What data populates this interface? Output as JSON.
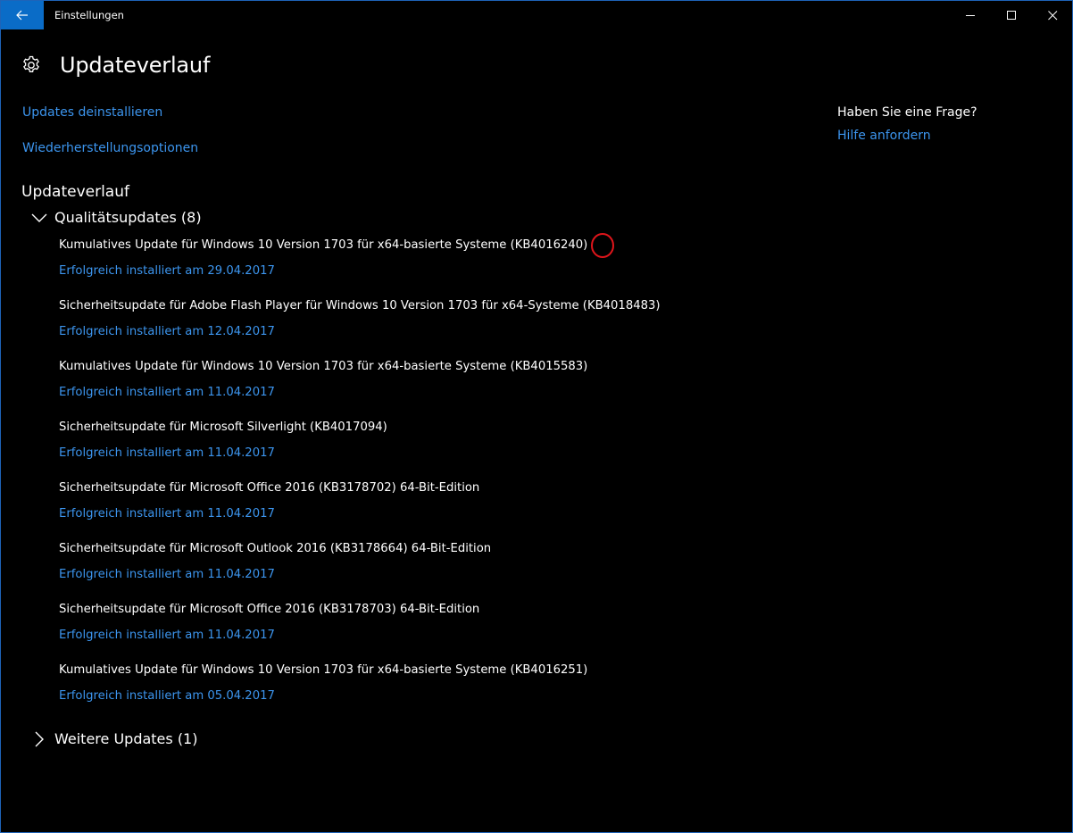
{
  "window": {
    "title": "Einstellungen",
    "accent_color": "#0a6cc7"
  },
  "header": {
    "icon": "gear-icon",
    "title": "Updateverlauf"
  },
  "links": {
    "uninstall": "Updates deinstallieren",
    "recovery": "Wiederherstellungsoptionen"
  },
  "history": {
    "section_title": "Updateverlauf",
    "quality_group": {
      "label": "Qualitätsupdates (8)",
      "expanded": true,
      "items": [
        {
          "name": "Kumulatives Update für Windows 10 Version 1703 für x64-basierte Systeme (KB4016240)",
          "status": "Erfolgreich installiert am 29.04.2017"
        },
        {
          "name": "Sicherheitsupdate für Adobe Flash Player für Windows 10 Version 1703 für x64-Systeme (KB4018483)",
          "status": "Erfolgreich installiert am 12.04.2017"
        },
        {
          "name": "Kumulatives Update für Windows 10 Version 1703 für x64-basierte Systeme (KB4015583)",
          "status": "Erfolgreich installiert am 11.04.2017"
        },
        {
          "name": "Sicherheitsupdate für Microsoft Silverlight (KB4017094)",
          "status": "Erfolgreich installiert am 11.04.2017"
        },
        {
          "name": "Sicherheitsupdate für Microsoft Office 2016 (KB3178702) 64-Bit-Edition",
          "status": "Erfolgreich installiert am 11.04.2017"
        },
        {
          "name": "Sicherheitsupdate für Microsoft Outlook 2016 (KB3178664) 64-Bit-Edition",
          "status": "Erfolgreich installiert am 11.04.2017"
        },
        {
          "name": "Sicherheitsupdate für Microsoft Office 2016 (KB3178703) 64-Bit-Edition",
          "status": "Erfolgreich installiert am 11.04.2017"
        },
        {
          "name": "Kumulatives Update für Windows 10 Version 1703 für x64-basierte Systeme (KB4016251)",
          "status": "Erfolgreich installiert am 05.04.2017"
        }
      ]
    },
    "further_group": {
      "label": "Weitere Updates (1)",
      "expanded": false
    }
  },
  "side": {
    "question": "Haben Sie eine Frage?",
    "help_link": "Hilfe anfordern"
  },
  "colors": {
    "link": "#3c95ee",
    "annotation": "#e0151b"
  }
}
